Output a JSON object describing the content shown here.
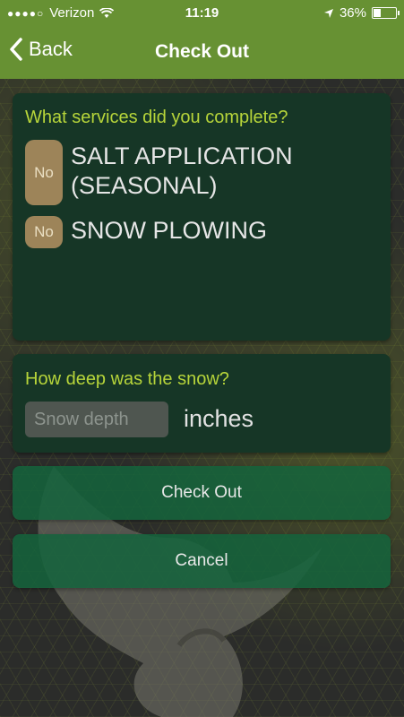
{
  "status_bar": {
    "carrier": "Verizon",
    "time": "11:19",
    "battery": "36%"
  },
  "nav": {
    "back_label": "Back",
    "title": "Check Out"
  },
  "services": {
    "question": "What services did you complete?",
    "items": [
      {
        "toggle": "No",
        "label": "SALT APPLICATION (SEASONAL)"
      },
      {
        "toggle": "No",
        "label": "SNOW PLOWING"
      }
    ]
  },
  "depth": {
    "question": "How deep was the snow?",
    "placeholder": "Snow depth",
    "unit": "inches"
  },
  "buttons": {
    "checkout": "Check Out",
    "cancel": "Cancel"
  },
  "colors": {
    "nav_green": "#679133",
    "card_bg": "#163626",
    "question_text": "#b7d53a",
    "toggle_bg": "#9d8459",
    "button_bg": "#14643c"
  }
}
